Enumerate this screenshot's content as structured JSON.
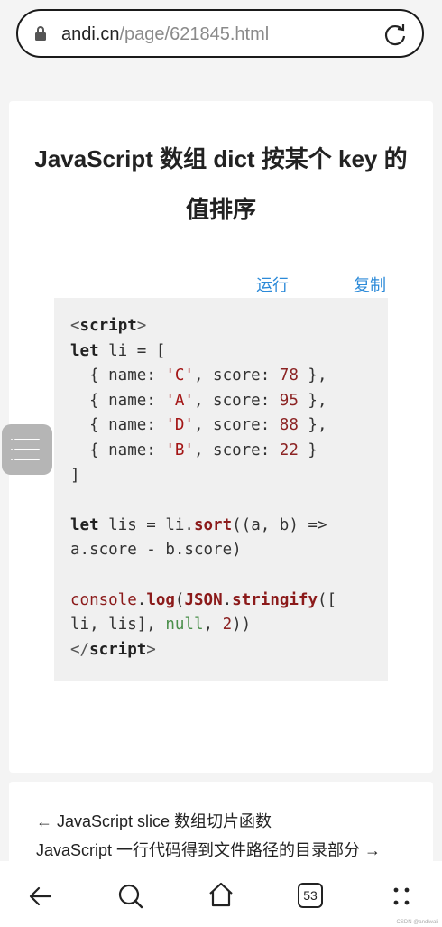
{
  "browser": {
    "url_host": "andi.cn",
    "url_path": "/page/621845.html",
    "tab_count": "53"
  },
  "article": {
    "title": "JavaScript 数组 dict 按某个 key 的值排序",
    "run_label": "运行",
    "copy_label": "复制"
  },
  "navigation": {
    "prev": "← JavaScript slice 数组切片函数",
    "next": "JavaScript 一行代码得到文件路径的目录部分 →"
  },
  "watermark": "CSDN @andiwali",
  "icons": [
    "lock-icon",
    "reload-icon",
    "menu-icon",
    "back-icon",
    "search-icon",
    "home-icon",
    "tabs-icon",
    "more-icon"
  ],
  "colors": {
    "link": "#2c8ad8",
    "code_bg": "#f0f0f0"
  }
}
